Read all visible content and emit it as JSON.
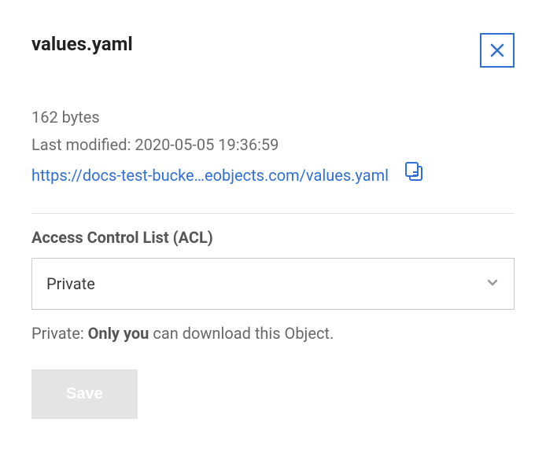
{
  "header": {
    "title": "values.yaml"
  },
  "meta": {
    "size": "162 bytes",
    "modified_prefix": "Last modified: ",
    "modified_value": "2020-05-05 19:36:59",
    "url": "https://docs-test-bucke…eobjects.com/values.yaml"
  },
  "acl": {
    "label": "Access Control List (ACL)",
    "selected": "Private",
    "helper_prefix": "Private: ",
    "helper_strong": "Only you",
    "helper_suffix": " can download this Object."
  },
  "actions": {
    "save_label": "Save"
  }
}
